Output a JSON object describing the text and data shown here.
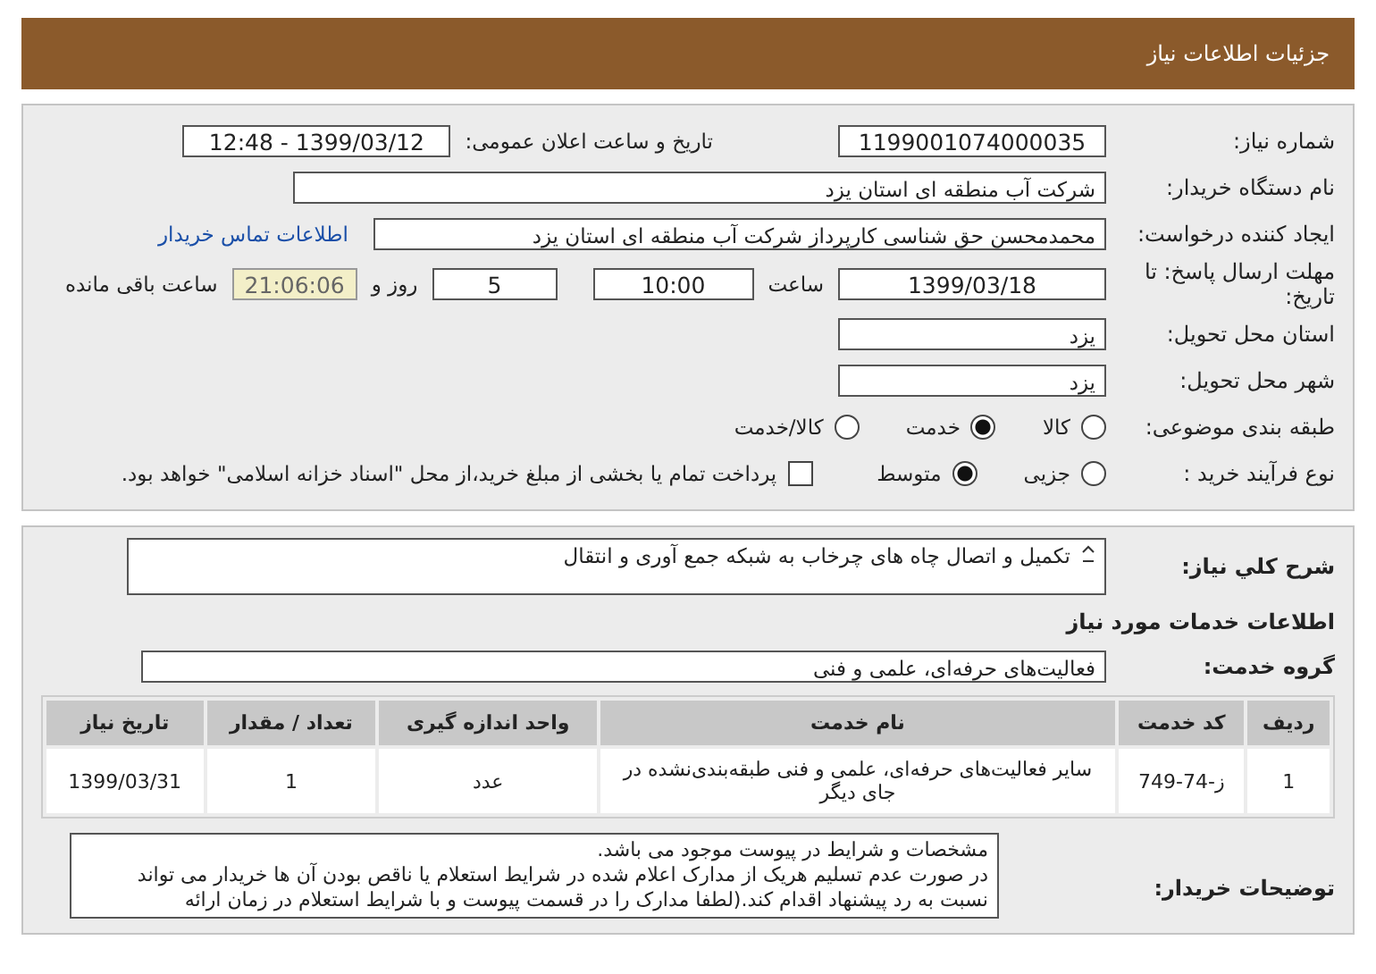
{
  "header_title": "جزئیات اطلاعات نیاز",
  "need_number": {
    "label": "شماره نیاز:",
    "value": "1199001074000035"
  },
  "announce": {
    "label": "تاریخ و ساعت اعلان عمومی:",
    "value": "1399/03/12 - 12:48"
  },
  "buyer_org": {
    "label": "نام دستگاه خریدار:",
    "value": "شرکت آب منطقه ای استان یزد"
  },
  "requester": {
    "label": "ایجاد کننده درخواست:",
    "value": "محمدمحسن حق شناسی کارپرداز شرکت آب منطقه ای استان یزد",
    "link": "اطلاعات تماس خریدار"
  },
  "deadline": {
    "label": "مهلت ارسال پاسخ: تا تاریخ:",
    "date": "1399/03/18",
    "time_label": "ساعت",
    "time": "10:00",
    "days": "5",
    "days_label": "روز و",
    "remaining": "21:06:06",
    "remaining_label": "ساعت باقی مانده"
  },
  "province": {
    "label": "استان محل تحویل:",
    "value": "یزد"
  },
  "city": {
    "label": "شهر محل تحویل:",
    "value": "یزد"
  },
  "category": {
    "label": "طبقه بندی موضوعی:",
    "options": [
      {
        "label": "کالا",
        "selected": false
      },
      {
        "label": "خدمت",
        "selected": true
      },
      {
        "label": "کالا/خدمت",
        "selected": false
      }
    ]
  },
  "process": {
    "label": "نوع فرآیند خرید :",
    "options": [
      {
        "label": "جزیی",
        "selected": false
      },
      {
        "label": "متوسط",
        "selected": true
      }
    ],
    "payment": {
      "label": "پرداخت تمام یا بخشی از مبلغ خرید،از محل \"اسناد خزانه اسلامی\" خواهد بود.",
      "checked": false
    }
  },
  "description": {
    "label": "شرح کلي نياز:",
    "value": "تکمیل و اتصال چاه های چرخاب به شبکه جمع آوری و انتقال"
  },
  "services_heading": "اطلاعات خدمات مورد نیاز",
  "service_group": {
    "label": "گروه خدمت:",
    "value": "فعالیت‌های حرفه‌ای، علمی و فنی"
  },
  "table": {
    "columns": [
      "ردیف",
      "کد خدمت",
      "نام خدمت",
      "واحد اندازه گیری",
      "تعداد / مقدار",
      "تاریخ نیاز"
    ],
    "rows": [
      [
        "1",
        "ز-74-749",
        "سایر فعالیت‌های حرفه‌ای، علمی و فنی طبقه‌بندی‌نشده در جای دیگر",
        "عدد",
        "1",
        "1399/03/31"
      ]
    ]
  },
  "buyer_notes": {
    "label": "توضیحات خریدار:",
    "lines": [
      "مشخصات و شرایط در پیوست موجود می باشد.",
      "در صورت عدم تسلیم هریک از مدارک اعلام شده در شرایط استعلام یا ناقص بودن آن ها خریدار می تواند",
      "نسبت به رد پیشنهاد اقدام کند.(لطفا مدارک را در قسمت پیوست و با شرایط استعلام در زمان ارائه"
    ]
  }
}
